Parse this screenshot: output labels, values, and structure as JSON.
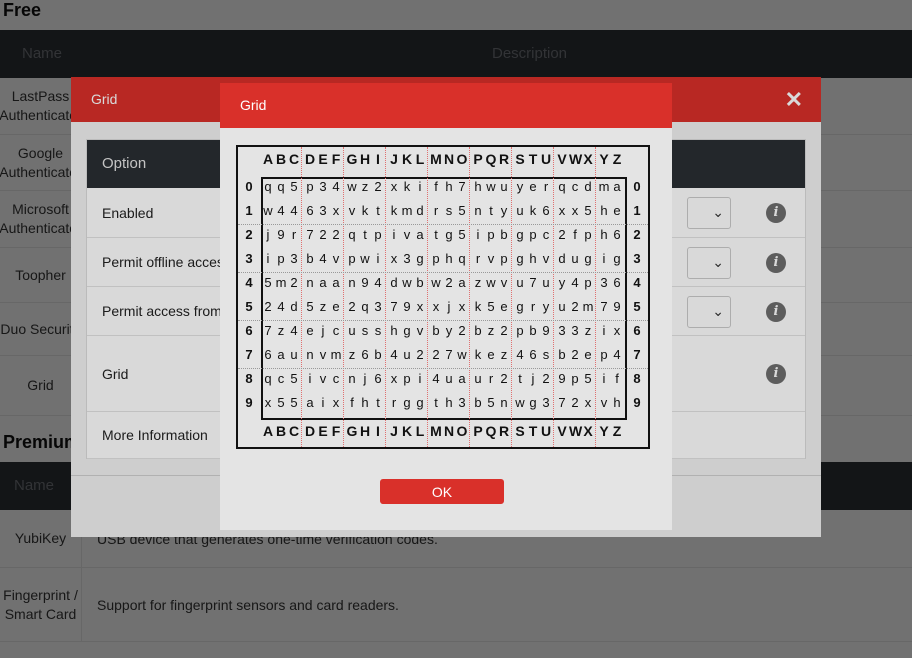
{
  "page": {
    "free_title": "Free",
    "premium_title": "Premium",
    "table_headers": {
      "name": "Name",
      "description": "Description"
    },
    "free_rows": [
      {
        "name": "LastPass Authenticator",
        "description": ""
      },
      {
        "name": "Google Authenticator",
        "description": ""
      },
      {
        "name": "Microsoft Authenticator",
        "description": ""
      },
      {
        "name": "Toopher",
        "description": ""
      },
      {
        "name": "Duo Security",
        "description": ""
      },
      {
        "name": "Grid",
        "description": ""
      }
    ],
    "premium_rows": [
      {
        "name": "YubiKey",
        "description": "USB device that generates one-time verification codes."
      },
      {
        "name": "Fingerprint / Smart Card",
        "description": "Support for fingerprint sensors and card readers."
      }
    ]
  },
  "modal": {
    "title": "Grid",
    "close_glyph": "✕",
    "option_header": "Option",
    "rows": [
      {
        "label": "Enabled",
        "has_select": true,
        "has_info": true
      },
      {
        "label": "Permit offline access",
        "has_select": true,
        "has_info": true
      },
      {
        "label": "Permit access from",
        "has_select": true,
        "has_info": true
      },
      {
        "label": "Grid",
        "has_select": false,
        "has_info": true
      },
      {
        "label": "More Information",
        "has_select": false,
        "has_info": false
      }
    ],
    "select_chevron": "⌄",
    "info_glyph": "i"
  },
  "grid_dialog": {
    "title": "Grid",
    "columns": [
      "A",
      "B",
      "C",
      "D",
      "E",
      "F",
      "G",
      "H",
      "I",
      "J",
      "K",
      "L",
      "M",
      "N",
      "O",
      "P",
      "Q",
      "R",
      "S",
      "T",
      "U",
      "V",
      "W",
      "X",
      "Y",
      "Z"
    ],
    "row_labels": [
      "0",
      "1",
      "2",
      "3",
      "4",
      "5",
      "6",
      "7",
      "8",
      "9"
    ],
    "rows": [
      [
        "q",
        "q",
        "5",
        "p",
        "3",
        "4",
        "w",
        "z",
        "2",
        "x",
        "k",
        "i",
        "f",
        "h",
        "7",
        "h",
        "w",
        "u",
        "y",
        "e",
        "r",
        "q",
        "c",
        "d",
        "m",
        "a"
      ],
      [
        "w",
        "4",
        "4",
        "6",
        "3",
        "x",
        "v",
        "k",
        "t",
        "k",
        "m",
        "d",
        "r",
        "s",
        "5",
        "n",
        "t",
        "y",
        "u",
        "k",
        "6",
        "x",
        "x",
        "5",
        "h",
        "e"
      ],
      [
        "j",
        "9",
        "r",
        "7",
        "2",
        "2",
        "q",
        "t",
        "p",
        "i",
        "v",
        "a",
        "t",
        "g",
        "5",
        "i",
        "p",
        "b",
        "g",
        "p",
        "c",
        "2",
        "f",
        "p",
        "h",
        "6"
      ],
      [
        "i",
        "p",
        "3",
        "b",
        "4",
        "v",
        "p",
        "w",
        "i",
        "x",
        "3",
        "g",
        "p",
        "h",
        "q",
        "r",
        "v",
        "p",
        "g",
        "h",
        "v",
        "d",
        "u",
        "g",
        "i",
        "g"
      ],
      [
        "5",
        "m",
        "2",
        "n",
        "a",
        "a",
        "n",
        "9",
        "4",
        "d",
        "w",
        "b",
        "w",
        "2",
        "a",
        "z",
        "w",
        "v",
        "u",
        "7",
        "u",
        "y",
        "4",
        "p",
        "3",
        "6"
      ],
      [
        "2",
        "4",
        "d",
        "5",
        "z",
        "e",
        "2",
        "q",
        "3",
        "7",
        "9",
        "x",
        "x",
        "j",
        "x",
        "k",
        "5",
        "e",
        "g",
        "r",
        "y",
        "u",
        "2",
        "m",
        "7",
        "9"
      ],
      [
        "7",
        "z",
        "4",
        "e",
        "j",
        "c",
        "u",
        "s",
        "s",
        "h",
        "g",
        "v",
        "b",
        "y",
        "2",
        "b",
        "z",
        "2",
        "p",
        "b",
        "9",
        "3",
        "3",
        "z",
        "i",
        "x"
      ],
      [
        "6",
        "a",
        "u",
        "n",
        "v",
        "m",
        "z",
        "6",
        "b",
        "4",
        "u",
        "2",
        "2",
        "7",
        "w",
        "k",
        "e",
        "z",
        "4",
        "6",
        "s",
        "b",
        "2",
        "e",
        "p",
        "4"
      ],
      [
        "q",
        "c",
        "5",
        "i",
        "v",
        "c",
        "n",
        "j",
        "6",
        "x",
        "p",
        "i",
        "4",
        "u",
        "a",
        "u",
        "r",
        "2",
        "t",
        "j",
        "2",
        "9",
        "p",
        "5",
        "i",
        "f"
      ],
      [
        "x",
        "5",
        "5",
        "a",
        "i",
        "x",
        "f",
        "h",
        "t",
        "r",
        "g",
        "g",
        "t",
        "h",
        "3",
        "b",
        "5",
        "n",
        "w",
        "g",
        "3",
        "7",
        "2",
        "x",
        "v",
        "h"
      ]
    ],
    "ok_label": "OK"
  }
}
